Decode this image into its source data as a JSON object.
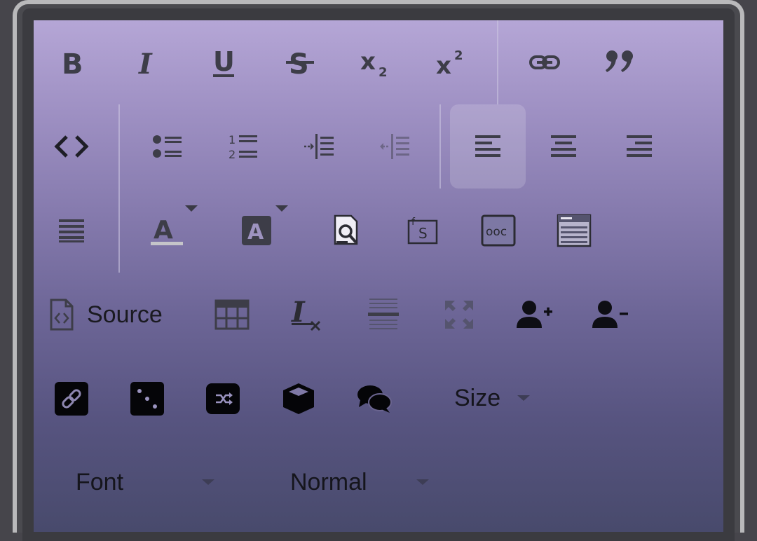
{
  "toolbar": {
    "source_label": "Source",
    "size_label": "Size",
    "font_label": "Font",
    "format_label": "Normal"
  },
  "icons": {
    "bold": "bold-icon",
    "italic": "italic-icon",
    "underline": "underline-icon",
    "strike": "strikethrough-icon",
    "subscript": "subscript-icon",
    "superscript": "superscript-icon",
    "link": "link-icon",
    "blockquote": "blockquote-icon",
    "code": "code-icon",
    "bulleted_list": "bulleted-list-icon",
    "numbered_list": "numbered-list-icon",
    "indent": "indent-icon",
    "outdent": "outdent-icon",
    "align_left": "align-left-icon",
    "align_center": "align-center-icon",
    "align_right": "align-right-icon",
    "justify": "justify-icon",
    "text_color": "text-color-icon",
    "background_color": "background-color-icon",
    "find": "find-icon",
    "special_char": "special-character-icon",
    "placeholder": "placeholder-icon",
    "templates": "templates-icon",
    "source": "source-icon",
    "table": "table-icon",
    "remove_format": "remove-format-icon",
    "horizontal_rule": "horizontal-rule-icon",
    "maximize": "maximize-icon",
    "add_user": "add-user-icon",
    "remove_user": "remove-user-icon",
    "anchor_link": "anchor-link-icon",
    "dice": "dice-icon",
    "shuffle": "shuffle-icon",
    "cube": "cube-icon",
    "comments": "comments-icon"
  },
  "colors": {
    "icon": "#3d3d48",
    "text_color_bar": "#c5c5c9",
    "active_bg": "#b9b2d3"
  }
}
